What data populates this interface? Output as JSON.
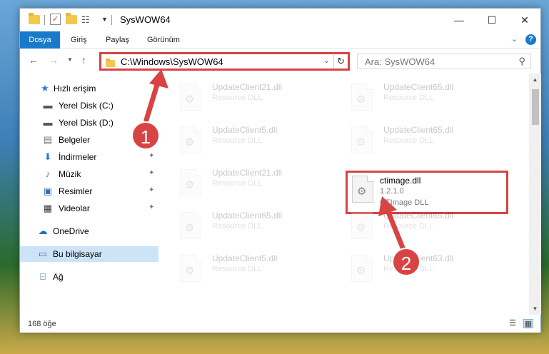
{
  "window": {
    "title": "SysWOW64",
    "controls": {
      "minimize": "—",
      "maximize": "☐",
      "close": "✕"
    }
  },
  "ribbon": {
    "tabs": [
      "Dosya",
      "Giriş",
      "Paylaş",
      "Görünüm"
    ],
    "active_tab": "Dosya",
    "expand_icon": "chevron-down-icon",
    "help_label": "?"
  },
  "address_bar": {
    "path": "C:\\Windows\\SysWOW64",
    "border_color": "#d84343"
  },
  "search": {
    "placeholder": "Ara: SysWOW64"
  },
  "sidebar": {
    "items": [
      {
        "label": "Hızlı erişim",
        "icon": "star-icon",
        "pinned": false
      },
      {
        "label": "Yerel Disk (C:)",
        "icon": "drive-icon",
        "pinned": false
      },
      {
        "label": "Yerel Disk (D:)",
        "icon": "drive-icon",
        "pinned": false
      },
      {
        "label": "Belgeler",
        "icon": "document-icon",
        "pinned": true
      },
      {
        "label": "İndirmeler",
        "icon": "download-icon",
        "pinned": true
      },
      {
        "label": "Müzik",
        "icon": "music-icon",
        "pinned": true
      },
      {
        "label": "Resimler",
        "icon": "picture-icon",
        "pinned": true
      },
      {
        "label": "Videolar",
        "icon": "video-icon",
        "pinned": true
      },
      {
        "label": "OneDrive",
        "icon": "cloud-icon",
        "pinned": false
      },
      {
        "label": "Bu bilgisayar",
        "icon": "computer-icon",
        "pinned": false,
        "selected": true
      },
      {
        "label": "Ağ",
        "icon": "network-icon",
        "pinned": false
      }
    ]
  },
  "files": [
    {
      "name": "UpdateClient21.dll",
      "desc": "Resource DLL",
      "version": ""
    },
    {
      "name": "UpdateClient65.dll",
      "desc": "Resource DLL",
      "version": ""
    },
    {
      "name": "UpdateClient5.dll",
      "desc": "Resource DLL",
      "version": ""
    },
    {
      "name": "UpdateClient65.dll",
      "desc": "Resource DLL",
      "version": ""
    },
    {
      "name": "UpdateClient21.dll",
      "desc": "Resource DLL",
      "version": ""
    },
    {
      "name": "ctimage.dll",
      "desc": "CTImage DLL",
      "version": "1.2.1.0"
    },
    {
      "name": "UpdateClient65.dll",
      "desc": "Resource DLL",
      "version": ""
    },
    {
      "name": "UpdateClient65.dll",
      "desc": "Resource DLL",
      "version": ""
    },
    {
      "name": "UpdateClient5.dll",
      "desc": "Resource DLL",
      "version": ""
    },
    {
      "name": "UpdateClient63.dll",
      "desc": "Resource DLL",
      "version": ""
    }
  ],
  "status": {
    "item_count": "168 öğe"
  },
  "annotations": {
    "badge_1": "1",
    "badge_2": "2",
    "color": "#d84343"
  }
}
